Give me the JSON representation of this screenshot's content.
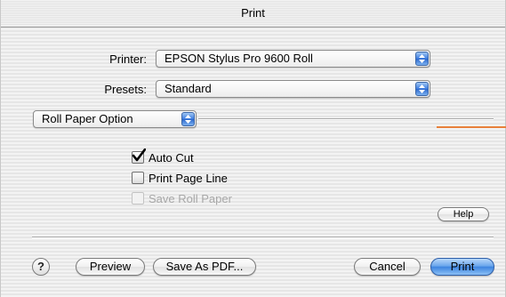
{
  "window": {
    "title": "Print"
  },
  "printer": {
    "label": "Printer:",
    "value": "EPSON Stylus Pro 9600 Roll"
  },
  "presets": {
    "label": "Presets:",
    "value": "Standard"
  },
  "panel": {
    "value": "Roll Paper Option"
  },
  "options": {
    "auto_cut": {
      "label": "Auto Cut",
      "checked": true
    },
    "print_page_line": {
      "label": "Print Page Line",
      "checked": false
    },
    "save_roll_paper": {
      "label": "Save Roll Paper",
      "checked": false,
      "enabled": false
    }
  },
  "buttons": {
    "help": "Help",
    "question": "?",
    "preview": "Preview",
    "save_as_pdf": "Save As PDF...",
    "cancel": "Cancel",
    "print": "Print"
  },
  "colors": {
    "accent": "#3d84e0",
    "orange_marker": "#e8803a"
  },
  "icons": {
    "popup_arrows": "up-down-arrows-icon",
    "checkmark": "checkmark-icon"
  }
}
